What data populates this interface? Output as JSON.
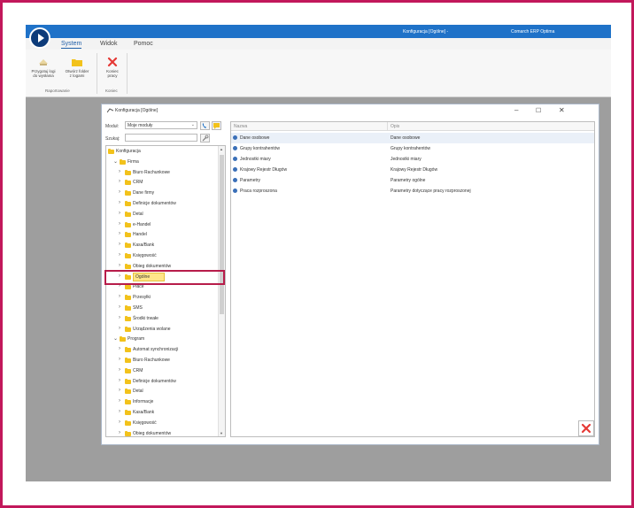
{
  "window": {
    "title": "Konfiguracja [Ogólne] -",
    "app_name": "Comarch ERP Optima"
  },
  "menu": [
    "System",
    "Widok",
    "Pomoc"
  ],
  "ribbon": {
    "buttons": [
      {
        "label1": "Przygotuj logi",
        "label2": "do wysłania",
        "icon": "log-icon"
      },
      {
        "label1": "Otwórz folder",
        "label2": "z logami",
        "icon": "folder-icon"
      },
      {
        "label1": "Koniec",
        "label2": "pracy",
        "icon": "close-x-icon"
      }
    ],
    "groups": [
      "Raportowanie",
      "Koniec"
    ]
  },
  "dialog": {
    "title": "Konfiguracja [Ogólne]",
    "module_label": "Moduł:",
    "module_value": "Moje moduły",
    "search_label": "Szukaj:",
    "search_value": "",
    "tree": [
      {
        "label": "Konfiguracja",
        "level": 0,
        "chev": ""
      },
      {
        "label": "Firma",
        "level": 1,
        "chev": "⌄"
      },
      {
        "label": "Biuro Rachunkowe",
        "level": 2,
        "chev": "›"
      },
      {
        "label": "CRM",
        "level": 2,
        "chev": "›"
      },
      {
        "label": "Dane firmy",
        "level": 2,
        "chev": "›"
      },
      {
        "label": "Definicje dokumentów",
        "level": 2,
        "chev": "›"
      },
      {
        "label": "Detal",
        "level": 2,
        "chev": "›"
      },
      {
        "label": "e-Handel",
        "level": 2,
        "chev": "›"
      },
      {
        "label": "Handel",
        "level": 2,
        "chev": "›"
      },
      {
        "label": "Kasa/Bank",
        "level": 2,
        "chev": "›"
      },
      {
        "label": "Księgowość",
        "level": 2,
        "chev": "›"
      },
      {
        "label": "Obieg dokumentów",
        "level": 2,
        "chev": "›"
      },
      {
        "label": "Ogólne",
        "level": 2,
        "chev": "›",
        "selected": true
      },
      {
        "label": "Płace",
        "level": 2,
        "chev": "›"
      },
      {
        "label": "Przesyłki",
        "level": 2,
        "chev": "›"
      },
      {
        "label": "SMS",
        "level": 2,
        "chev": "›"
      },
      {
        "label": "Środki trwałe",
        "level": 2,
        "chev": "›"
      },
      {
        "label": "Urządzenia wolane",
        "level": 2,
        "chev": "›"
      },
      {
        "label": "Program",
        "level": 1,
        "chev": "⌄"
      },
      {
        "label": "Automat synchronizacji",
        "level": 2,
        "chev": "›"
      },
      {
        "label": "Biuro Rachunkowe",
        "level": 2,
        "chev": "›"
      },
      {
        "label": "CRM",
        "level": 2,
        "chev": "›"
      },
      {
        "label": "Definicje dokumentów",
        "level": 2,
        "chev": "›"
      },
      {
        "label": "Detal",
        "level": 2,
        "chev": "›"
      },
      {
        "label": "Informacje",
        "level": 2,
        "chev": "›"
      },
      {
        "label": "Kasa/Bank",
        "level": 2,
        "chev": "›"
      },
      {
        "label": "Księgowość",
        "level": 2,
        "chev": "›"
      },
      {
        "label": "Obieg dokumentów",
        "level": 2,
        "chev": "›"
      }
    ],
    "grid": {
      "columns": [
        "Nazwa",
        "Opis"
      ],
      "rows": [
        {
          "name": "Dane osobowe",
          "desc": "Dane osobowe"
        },
        {
          "name": "Grupy kontrahentów",
          "desc": "Grupy kontrahentów"
        },
        {
          "name": "Jednostki miary",
          "desc": "Jednostki miary"
        },
        {
          "name": "Krajowy Rejestr Długów",
          "desc": "Krajowy Rejestr Długów"
        },
        {
          "name": "Parametry",
          "desc": "Parametry ogólne"
        },
        {
          "name": "Praca rozproszona",
          "desc": "Parametry dotyczące pracy rozproszonej"
        }
      ]
    }
  },
  "colors": {
    "titlebar": "#1f72c8",
    "highlight": "#b71c4a",
    "folder": "#f2c21b",
    "selected_row": "#ffe58a"
  }
}
